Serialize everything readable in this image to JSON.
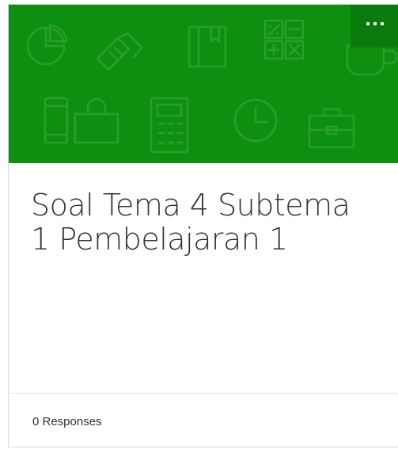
{
  "card": {
    "title_line1": "Soal Tema 4 Subtema",
    "title_line2": "1 Pembelajaran 1",
    "responses_label": "0 Responses",
    "banner_color": "#0f8f10",
    "banner_pattern_icons": [
      "pie-chart-icon",
      "handshake-icon",
      "book-icon",
      "calculator-grid-icon",
      "coffee-cup-icon",
      "phone-icon",
      "shopping-bag-icon",
      "calculator-icon",
      "clock-icon",
      "briefcase-icon"
    ]
  },
  "menu": {
    "icon": "more-options-icon"
  }
}
